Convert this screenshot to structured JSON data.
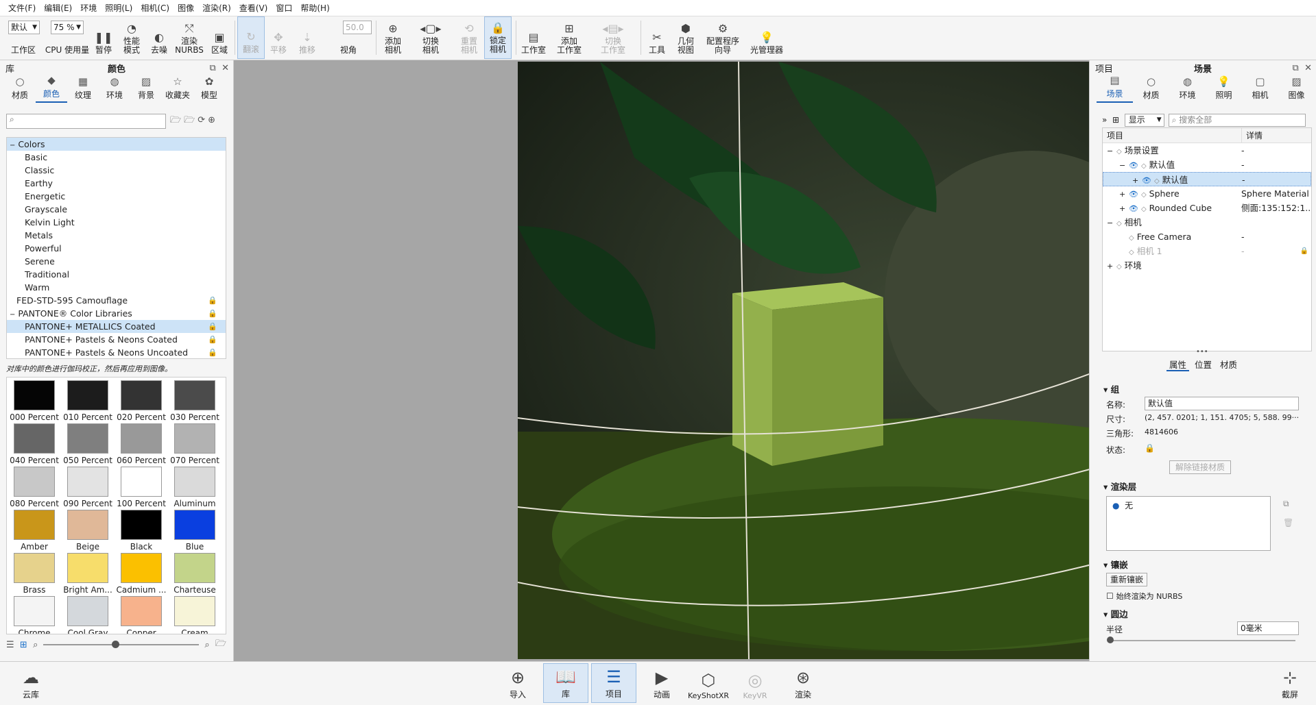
{
  "menu": [
    "文件(F)",
    "编辑(E)",
    "环境",
    "照明(L)",
    "相机(C)",
    "图像",
    "渲染(R)",
    "查看(V)",
    "窗口",
    "帮助(H)"
  ],
  "toolbar": {
    "workspace_combo": "默认",
    "workspace_label": "工作区",
    "cpu_combo": "75 %",
    "cpu_label": "CPU 使用量",
    "pause": "暂停",
    "perf": "性能\n模式",
    "denoise": "去噪",
    "nurbs": "渲染\nNURBS",
    "region": "区域",
    "tumble": "翻滚",
    "pan": "平移",
    "dolly": "推移",
    "fov_value": "50.0",
    "fov_label": "视角",
    "add_camera": "添加\n相机",
    "switch_camera": "切换\n相机",
    "reset_camera": "重置\n相机",
    "lock_camera": "锁定\n相机",
    "studio": "工作室",
    "add_studio": "添加\n工作室",
    "switch_studio": "切换\n工作室",
    "tools": "工具",
    "geometry_view": "几何\n视图",
    "config_wizard": "配置程序\n向导",
    "light_manager": "光管理器"
  },
  "library": {
    "panel_left_label": "库",
    "panel_title": "颜色",
    "tabs": [
      "材质",
      "颜色",
      "纹理",
      "环境",
      "背景",
      "收藏夹",
      "模型"
    ],
    "selected_tab": 1,
    "search_placeholder": "",
    "tree": [
      {
        "label": "Colors",
        "level": 0,
        "expander": "−",
        "highlight": true
      },
      {
        "label": "Basic",
        "level": 1
      },
      {
        "label": "Classic",
        "level": 1
      },
      {
        "label": "Earthy",
        "level": 1
      },
      {
        "label": "Energetic",
        "level": 1
      },
      {
        "label": "Grayscale",
        "level": 1
      },
      {
        "label": "Kelvin Light",
        "level": 1
      },
      {
        "label": "Metals",
        "level": 1
      },
      {
        "label": "Powerful",
        "level": 1
      },
      {
        "label": "Serene",
        "level": 1
      },
      {
        "label": "Traditional",
        "level": 1
      },
      {
        "label": "Warm",
        "level": 1
      },
      {
        "label": "FED-STD-595 Camouflage",
        "level": 0,
        "lock": true
      },
      {
        "label": "PANTONE® Color Libraries",
        "level": 0,
        "expander": "−",
        "lock": true
      },
      {
        "label": "PANTONE+ METALLICS Coated",
        "level": 1,
        "lock": true,
        "highlight": true
      },
      {
        "label": "PANTONE+ Pastels & Neons Coated",
        "level": 1,
        "lock": true
      },
      {
        "label": "PANTONE+ Pastels & Neons Uncoated",
        "level": 1,
        "lock": true
      }
    ],
    "hint": "对库中的颜色进行伽玛校正，然后再应用到图像。",
    "swatches": [
      {
        "label": "000 Percent",
        "color": "#050505"
      },
      {
        "label": "010 Percent",
        "color": "#1c1c1c"
      },
      {
        "label": "020 Percent",
        "color": "#333333"
      },
      {
        "label": "030 Percent",
        "color": "#4b4b4b"
      },
      {
        "label": "040 Percent",
        "color": "#666666"
      },
      {
        "label": "050 Percent",
        "color": "#7f7f7f"
      },
      {
        "label": "060 Percent",
        "color": "#999999"
      },
      {
        "label": "070 Percent",
        "color": "#b2b2b2"
      },
      {
        "label": "080 Percent",
        "color": "#c8c8c8"
      },
      {
        "label": "090 Percent",
        "color": "#e3e3e3"
      },
      {
        "label": "100 Percent",
        "color": "#ffffff"
      },
      {
        "label": "Aluminum",
        "color": "#dadada"
      },
      {
        "label": "Amber",
        "color": "#c9961a"
      },
      {
        "label": "Beige",
        "color": "#e0b898"
      },
      {
        "label": "Black",
        "color": "#000000"
      },
      {
        "label": "Blue",
        "color": "#0a3fe0"
      },
      {
        "label": "Brass",
        "color": "#e6d28c"
      },
      {
        "label": "Bright Am...",
        "color": "#f7dd6b"
      },
      {
        "label": "Cadmium ...",
        "color": "#fbc000"
      },
      {
        "label": "Charteuse",
        "color": "#c3d48a"
      },
      {
        "label": "Chrome",
        "color": "#f4f4f4"
      },
      {
        "label": "Cool Gray",
        "color": "#d4d8dc"
      },
      {
        "label": "Copper",
        "color": "#f7b28c"
      },
      {
        "label": "Cream",
        "color": "#f7f4d8"
      }
    ]
  },
  "scene": {
    "panel_left_label": "项目",
    "panel_title": "场景",
    "tabs": [
      "场景",
      "材质",
      "环境",
      "照明",
      "相机",
      "图像"
    ],
    "selected_tab": 0,
    "show_combo": "显示",
    "search_placeholder": "搜索全部",
    "col_item": "项目",
    "col_detail": "详情",
    "rows": [
      {
        "label": "场景设置",
        "detail": "-",
        "indent": 0,
        "exp": "−"
      },
      {
        "label": "默认值",
        "detail": "-",
        "indent": 1,
        "exp": "−",
        "eye": true
      },
      {
        "label": "默认值",
        "detail": "-",
        "indent": 2,
        "exp": "+",
        "eye": true,
        "selected": true
      },
      {
        "label": "Sphere",
        "detail": "Sphere Material",
        "indent": 1,
        "exp": "+",
        "eye": true
      },
      {
        "label": "Rounded Cube",
        "detail": "侧面:135:152:1...",
        "indent": 1,
        "exp": "+",
        "eye": true
      },
      {
        "label": "相机",
        "detail": "",
        "indent": 0,
        "exp": "−"
      },
      {
        "label": "Free Camera",
        "detail": "-",
        "indent": 1
      },
      {
        "label": "相机 1",
        "detail": "-",
        "indent": 1,
        "dim": true,
        "lock": true
      },
      {
        "label": "环境",
        "detail": "",
        "indent": 0,
        "exp": "+"
      }
    ],
    "subtabs": [
      "属性",
      "位置",
      "材质"
    ],
    "group": {
      "title": "组",
      "name_label": "名称:",
      "name_value": "默认值",
      "size_label": "尺寸:",
      "size_value": "(2, 457. 0201; 1, 151. 4705; 5, 588. 99···",
      "tri_label": "三角形:",
      "tri_value": "4814606",
      "state_label": "状态:",
      "unlink_btn": "解除链接材质"
    },
    "render_layers": {
      "title": "渲染层",
      "item": "无"
    },
    "tessellation": {
      "title": "镶嵌",
      "retess_btn": "重新镶嵌",
      "always_nurbs": "始终渲染为 NURBS"
    },
    "rounding": {
      "title": "圆边",
      "radius_label": "半径",
      "radius_value": "0毫米"
    }
  },
  "bottombar": {
    "cloud": "云库",
    "import": "导入",
    "library": "库",
    "project": "项目",
    "animation": "动画",
    "keyshotxr": "KeyShotXR",
    "keyvr": "KeyVR",
    "render": "渲染",
    "screenshot": "截屏"
  }
}
